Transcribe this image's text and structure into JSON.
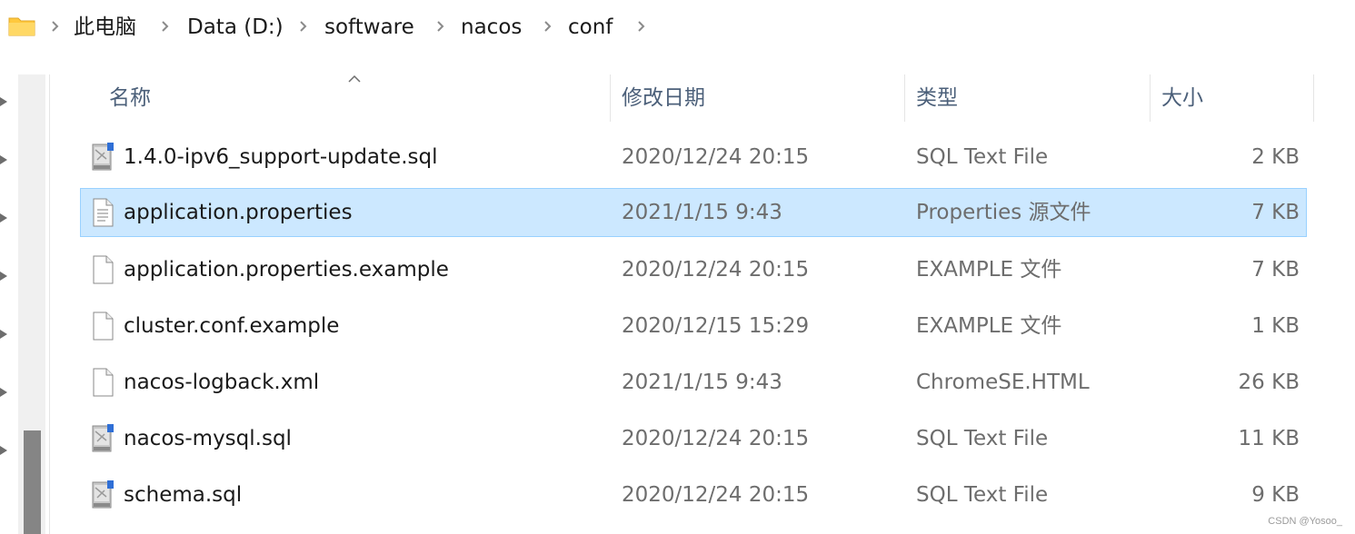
{
  "breadcrumb": {
    "items": [
      "此电脑",
      "Data (D:)",
      "software",
      "nacos",
      "conf"
    ]
  },
  "columns": {
    "name": "名称",
    "date": "修改日期",
    "type": "类型",
    "size": "大小"
  },
  "sort": {
    "column": "name",
    "direction": "ascending"
  },
  "files": [
    {
      "name": "1.4.0-ipv6_support-update.sql",
      "date": "2020/12/24 20:15",
      "type": "SQL Text File",
      "size": "2 KB",
      "icon": "sql-file-icon",
      "selected": false
    },
    {
      "name": "application.properties",
      "date": "2021/1/15 9:43",
      "type": "Properties 源文件",
      "size": "7 KB",
      "icon": "properties-file-icon",
      "selected": true
    },
    {
      "name": "application.properties.example",
      "date": "2020/12/24 20:15",
      "type": "EXAMPLE 文件",
      "size": "7 KB",
      "icon": "generic-file-icon",
      "selected": false
    },
    {
      "name": "cluster.conf.example",
      "date": "2020/12/15 15:29",
      "type": "EXAMPLE 文件",
      "size": "1 KB",
      "icon": "generic-file-icon",
      "selected": false
    },
    {
      "name": "nacos-logback.xml",
      "date": "2021/1/15 9:43",
      "type": "ChromeSE.HTML",
      "size": "26 KB",
      "icon": "generic-file-icon",
      "selected": false
    },
    {
      "name": "nacos-mysql.sql",
      "date": "2020/12/24 20:15",
      "type": "SQL Text File",
      "size": "11 KB",
      "icon": "sql-file-icon",
      "selected": false
    },
    {
      "name": "schema.sql",
      "date": "2020/12/24 20:15",
      "type": "SQL Text File",
      "size": "9 KB",
      "icon": "sql-file-icon",
      "selected": false
    }
  ],
  "watermark": "CSDN @Yosoo_",
  "colors": {
    "selection_bg": "#cce8ff",
    "selection_border": "#99d1ff",
    "header_text": "#4c607a",
    "secondary_text": "#6d6d6d",
    "folder_yellow": "#ffc83d"
  }
}
